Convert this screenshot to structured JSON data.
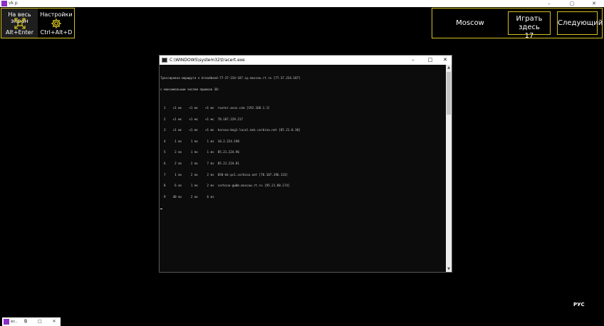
{
  "app_window": {
    "title": "vk p",
    "controls": {
      "minimize": "–",
      "maximize": "▢",
      "close": "✕"
    }
  },
  "toolbar": {
    "fullscreen": {
      "label": "На весь экран",
      "hotkey": "Alt+Enter",
      "icon": "fullscreen-icon"
    },
    "settings": {
      "label": "Настройки",
      "hotkey": "Ctrl+Alt+D",
      "icon": "gear-icon"
    }
  },
  "game_panel": {
    "city": "Moscow",
    "play_here_label": "Играть здесь",
    "play_here_count": "17",
    "next_label": "Следующий"
  },
  "colors": {
    "accent": "#d4c020",
    "app_icon": "#8b2fc9"
  },
  "cmd_window": {
    "title": "C:\\WINDOWS\\system32\\tracert.exe",
    "controls": {
      "minimize": "–",
      "maximize": "□",
      "close": "✕"
    },
    "lines": [
      "Трассировка маршрута к broadband-77-37-234-187.ip.moscow.rt.ru [77.37.234.187]",
      "с максимальным числом прыжков 30:",
      "",
      "  1    <1 мс    <1 мс    <1 мс  router.asus.com [192.168.1.1]",
      "  2    <1 мс    <1 мс    <1 мс  78.107.229.217",
      "  3    <1 мс    <1 мс    <1 мс  korova-bng1-local.msk.corbina.net [85.21.0.30]",
      "  4     1 ms     1 ms     1 ms  10.2.224.190",
      "  5     2 ms     1 ms     1 ms  85.21.224.96",
      "  6     2 ms     2 ms     7 ms  85.21.224.81",
      "  7     1 ms     2 ms     2 ms  858-kk-pc1.corbina.net [78.107.196.133]",
      "  8     6 ms     1 ms     2 ms  corbina-gw8m.moscow.rt.ru [95.21.80.174]",
      "  9    40 ms     2 ms     6 ms  "
    ]
  },
  "language_indicator": "РУС",
  "taskbar": {
    "app_title": "вс..",
    "controls": {
      "restore": "⧉",
      "maximize": "□",
      "close": "✕"
    }
  }
}
